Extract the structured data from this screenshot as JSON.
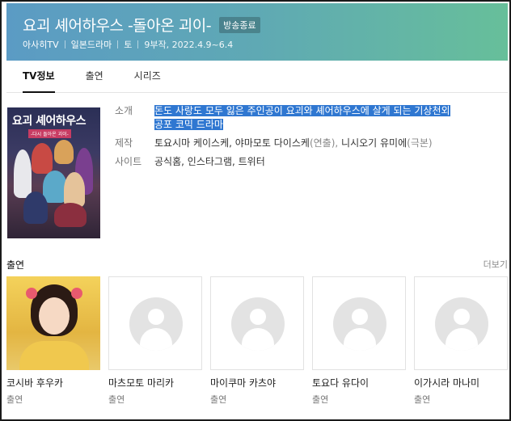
{
  "header": {
    "title": "요괴 셰어하우스 -돌아온 괴이-",
    "badge": "방송종료",
    "channel": "아사히TV",
    "genre": "일본드라마",
    "day": "토",
    "episodes_dates": "9부작, 2022.4.9~6.4"
  },
  "tabs": [
    {
      "label": "TV정보",
      "active": true
    },
    {
      "label": "출연",
      "active": false
    },
    {
      "label": "시리즈",
      "active": false
    }
  ],
  "poster": {
    "title": "요괴 셰어하우스",
    "subtitle": "-다시 돌아온 괴이-"
  },
  "info": {
    "intro_label": "소개",
    "intro_line1": "돈도 사랑도 모두 잃은 주인공이 요괴와 셰어하우스에 살게 되는 기상천외",
    "intro_line2": "공포 코믹 드라마",
    "production_label": "제작",
    "producer1": "토요시마 케이스케",
    "producer2": "야마모토 다이스케",
    "producer2_role": "(연출),",
    "producer3": "니시오기 유미에",
    "producer3_role": "(극본)",
    "site_label": "사이트",
    "sites": [
      "공식홈",
      "인스타그램",
      "트위터"
    ],
    "site_sep": ","
  },
  "cast": {
    "title": "출연",
    "more": "더보기",
    "members": [
      {
        "name": "코시바 후우카",
        "role": "출연"
      },
      {
        "name": "마츠모토 마리카",
        "role": "출연"
      },
      {
        "name": "마이쿠마 카츠야",
        "role": "출연"
      },
      {
        "name": "토요다 유다이",
        "role": "출연"
      },
      {
        "name": "이가시라 마나미",
        "role": "출연"
      }
    ]
  }
}
